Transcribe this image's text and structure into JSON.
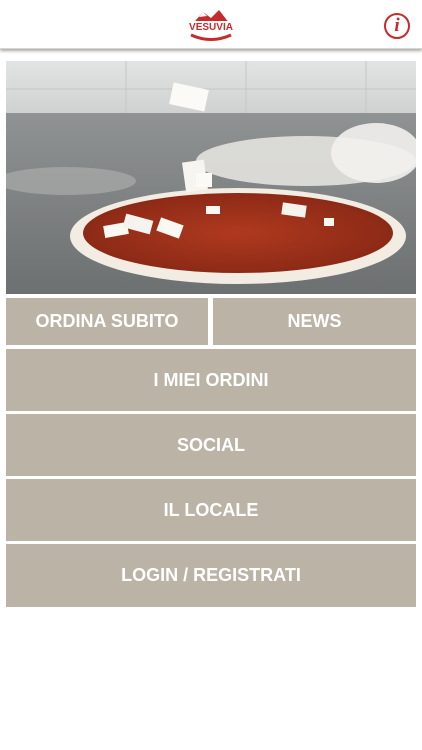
{
  "header": {
    "logo_text": "VESUVIA",
    "info_label": "i",
    "icons": {
      "logo": "vesuvia-logo-icon",
      "info": "info-icon"
    }
  },
  "hero": {
    "icon": "pizza-photo"
  },
  "menu": {
    "order_now": "ORDINA SUBITO",
    "news": "NEWS",
    "my_orders": "I MIEI ORDINI",
    "social": "SOCIAL",
    "the_place": "IL LOCALE",
    "login_register": "LOGIN / REGISTRATI"
  },
  "colors": {
    "tile_background": "#bbb3a6",
    "tile_text": "#ffffff",
    "brand_red": "#c62a2a"
  }
}
